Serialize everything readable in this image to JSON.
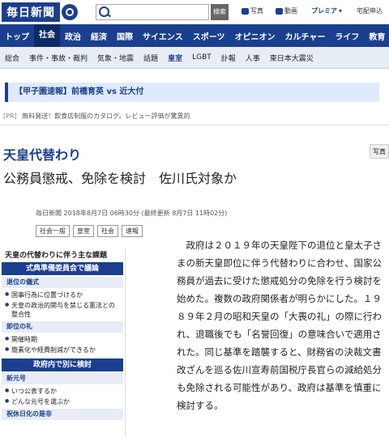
{
  "header": {
    "logo_text": "毎日新聞",
    "search_placeholder": "",
    "search_button": "検索",
    "tools": [
      "写真",
      "動画"
    ],
    "premium": "プレミア",
    "delivery": "宅配申込"
  },
  "global_nav": [
    "トップ",
    "社会",
    "政治",
    "経済",
    "国際",
    "サイエンス",
    "スポーツ",
    "オピニオン",
    "カルチャー",
    "ライフ",
    "教育"
  ],
  "global_nav_active": 1,
  "sub_nav": [
    "総合",
    "事件・事故・裁判",
    "気象・地震",
    "話題",
    "皇室",
    "LGBT",
    "訃報",
    "人事",
    "東日本大震災"
  ],
  "sub_nav_active": 4,
  "breaking": "【甲子園速報】前橋育英 vs 近大付",
  "pr": {
    "tag": "[PR]",
    "text": "無料発送！飲食店制服のカタログ。レビュー評価が驚異的"
  },
  "article": {
    "kicker": "天皇代替わり",
    "headline": "公務員懲戒、免除を検討　佐川氏対象か",
    "photo_tab": "写真",
    "meta": "毎日新聞 2018年8月7日 06時30分 (最終更新 8月7日 11時02分)",
    "tags": [
      "社会一般",
      "皇室",
      "社会",
      "速報"
    ],
    "body": "政府は２０１９年の天皇陛下の退位と皇太子さまの新天皇即位に伴う代替わりに合わせ、国家公務員が過去に受けた懲戒処分の免除を行う検討を始めた。複数の政府関係者が明らかにした。１９８９年２月の昭和天皇の「大喪の礼」の際に行われ、退職後でも「名誉回復」の意味合いで適用された。同じ基準を踏襲すると、財務省の決裁文書改ざんを巡る佐川宣寿前国税庁長官らの減給処分も免除される可能性があり、政府は基準を慎重に検討する。"
  },
  "sidebar": {
    "title": "天皇の代替わりに伴う主な課題",
    "band1": "式典準備委員会で議論",
    "sec1": "退位の儀式",
    "items1": [
      "国事行為に位置づけるか",
      "天皇の政治的関与を禁じる憲法との整合性"
    ],
    "sec2": "即位の礼",
    "items2": [
      "開催時期",
      "簡素化や経費削減ができるか"
    ],
    "band2": "政府内で別に検討",
    "sec3": "新元号",
    "items3": [
      "いつ公表するか",
      "どんな元号を選ぶか"
    ],
    "sec4": "祝休日化の是非"
  }
}
